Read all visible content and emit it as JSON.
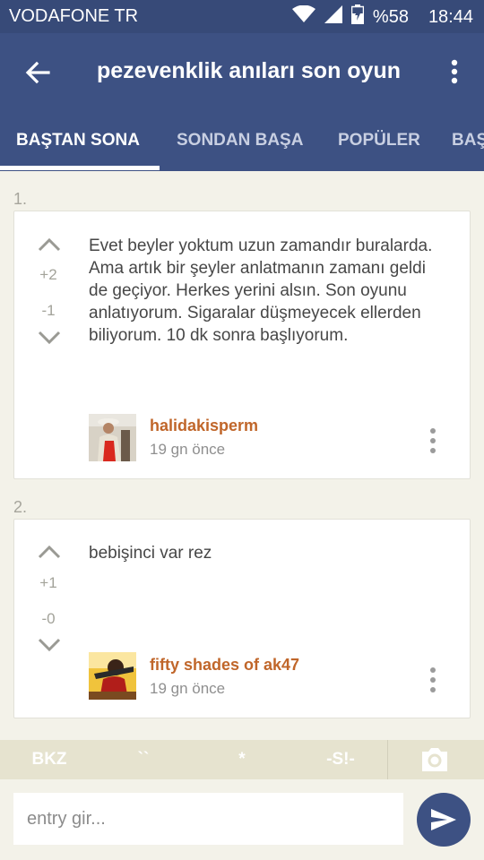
{
  "status_bar": {
    "carrier": "VODAFONE TR",
    "battery": "%58",
    "time": "18:44",
    "icons": [
      "wifi-icon",
      "signal-icon",
      "battery-icon"
    ]
  },
  "app_bar": {
    "title": "pezevenklik anıları son oyun",
    "icons": [
      "back-arrow-icon",
      "more-vert-icon"
    ]
  },
  "tabs": [
    {
      "label": "BAŞTAN SONA",
      "active": true
    },
    {
      "label": "SONDAN BAŞA",
      "active": false
    },
    {
      "label": "POPÜLER",
      "active": false
    },
    {
      "label": "BAŞ",
      "active": false
    }
  ],
  "entries": [
    {
      "number": "1.",
      "up_votes": "+2",
      "down_votes": "-1",
      "text": "Evet beyler yoktum uzun zamandır buralarda. Ama artık bir şeyler anlatmanın zamanı geldi de geçiyor. Herkes yerini alsın. Son oyunu anlatıyorum. Sigaralar düşmeyecek ellerden biliyorum. 10 dk sonra başlıyorum.",
      "author": "halidakisperm",
      "time": "19 gn  önce"
    },
    {
      "number": "2.",
      "up_votes": "+1",
      "down_votes": "-0",
      "text": "bebişinci var rez",
      "author": "fifty shades of ak47",
      "time": "19 gn  önce"
    }
  ],
  "format_bar": {
    "bkz": "BKZ",
    "backtick": "``",
    "star": "*",
    "spoiler": "-S!-",
    "icons": [
      "camera-icon"
    ]
  },
  "input": {
    "placeholder": "entry gir...",
    "value": "",
    "icons": [
      "send-icon"
    ]
  },
  "colors": {
    "status_bar": "#374a78",
    "app_bar": "#3d5183",
    "background": "#f3f2e9",
    "author": "#c0662a",
    "format_bar": "#e6e3cf"
  }
}
